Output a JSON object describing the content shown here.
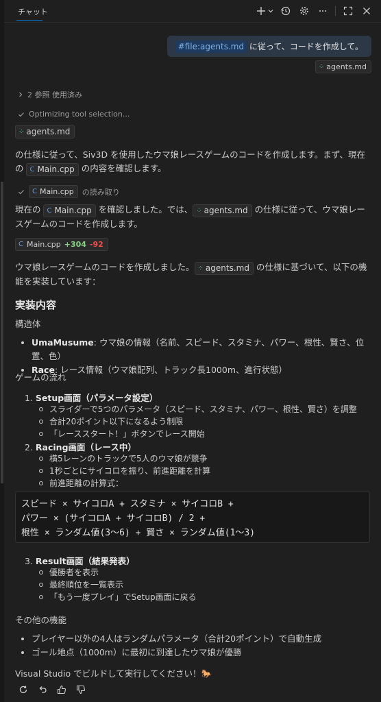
{
  "header": {
    "tab_title": "チャット"
  },
  "user_message": {
    "file_ref": "#file:agents.md",
    "text": " に従って、コードを作成して。",
    "attachment": "agents.md"
  },
  "references": {
    "label": "2 参照 使用済み"
  },
  "optimizing": "Optimizing tool selection...",
  "agents_chip": "agents.md",
  "intro": {
    "part1": "の仕様に従って、Siv3D を使用したウマ娘レースゲームのコードを作成します。まず、現在の ",
    "chip": "Main.cpp",
    "part2": " の内容を確認します。"
  },
  "read_op": {
    "file": "Main.cpp",
    "label": "の読み取り"
  },
  "confirm": {
    "part1": "現在の ",
    "chip1": "Main.cpp",
    "part2": " を確認しました。では、",
    "chip2": "agents.md",
    "part3": " の仕様に従って、ウマ娘レースゲームのコードを作成します。"
  },
  "diff": {
    "file": "Main.cpp",
    "added": "+304",
    "removed": "-92"
  },
  "done": {
    "part1": "ウマ娘レースゲームのコードを作成しました。",
    "chip": "agents.md",
    "part2": " の仕様に基づいて、以下の機能を実装しています："
  },
  "impl": {
    "heading": "実装内容",
    "struct_label": "構造体",
    "structs": [
      {
        "name": "UmaMusume",
        "desc": ": ウマ娘の情報（名前、スピード、スタミナ、パワー、根性、賢さ、位置、色）"
      },
      {
        "name": "Race",
        "desc": ": レース情報（ウマ娘配列、トラック長1000m、進行状態）"
      }
    ],
    "flow_label": "ゲームの流れ",
    "step1": {
      "num": "1.",
      "title": "Setup画面（パラメータ設定）",
      "items": [
        "スライダーで5つのパラメータ（スピード、スタミナ、パワー、根性、賢さ）を調整",
        "合計20ポイント以下になるよう制限",
        "「レーススタート！」ボタンでレース開始"
      ]
    },
    "step2": {
      "num": "2.",
      "title": "Racing画面（レース中）",
      "items": [
        "横5レーンのトラックで5人のウマ娘が競争",
        "1秒ごとにサイコロを振り、前進距離を計算",
        "前進距離の計算式："
      ]
    },
    "code": [
      "スピード × サイコロA + スタミナ × サイコロB +",
      "パワー × (サイコロA + サイコロB) / 2 +",
      "根性 × ランダム値(3～6) + 賢さ × ランダム値(1～3)"
    ],
    "step3": {
      "num": "3.",
      "title": "Result画面（結果発表）",
      "items": [
        "優勝者を表示",
        "最終順位を一覧表示",
        "「もう一度プレイ」でSetup画面に戻る"
      ]
    },
    "other_label": "その他の機能",
    "others": [
      "プレイヤー以外の4人はランダムパラメータ（合計20ポイント）で自動生成",
      "ゴール地点（1000m）に最初に到達したウマ娘が優勝"
    ],
    "closing": "Visual Studio でビルドして実行してください！🐎"
  }
}
